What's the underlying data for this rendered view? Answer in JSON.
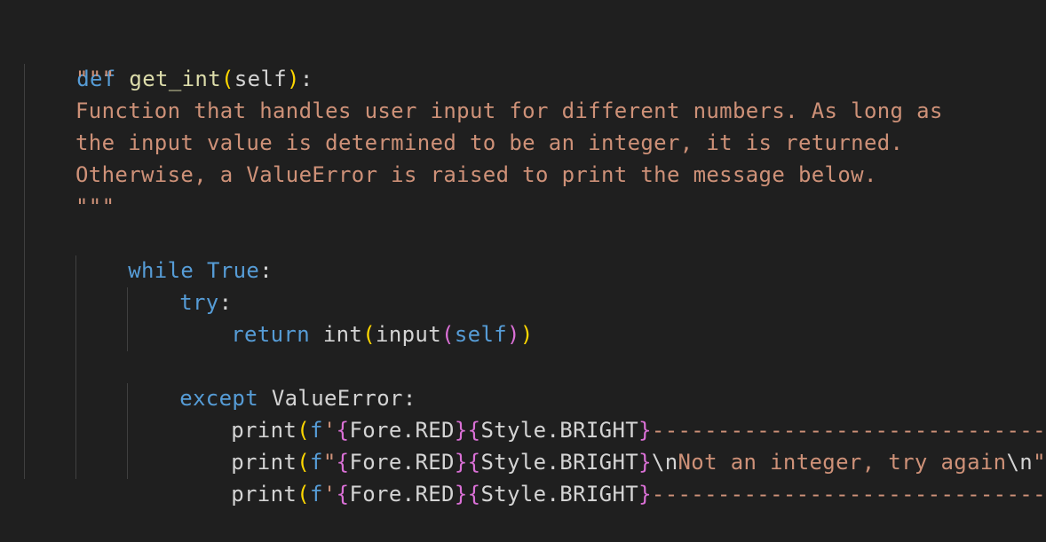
{
  "editor": {
    "theme": {
      "background": "#1f1f1f",
      "keyword": "#569cd6",
      "text": "#d4d4d4",
      "string": "#ce9178",
      "bracket_level1": "#ffd700",
      "bracket_level2": "#da70d6",
      "bracket_level3": "#179fff",
      "indent_guide": "#404040"
    },
    "line1": {
      "def": "def",
      "name": "get_int",
      "open": "(",
      "param": "self",
      "close": ")",
      "colon": ":"
    },
    "docstring": {
      "open_quotes": "\"\"\"",
      "line1": "Function that handles user input for different numbers. As long as",
      "line2": "the input value is determined to be an integer, it is returned.",
      "line3": "Otherwise, a ValueError is raised to print the message below.",
      "close_quotes": "\"\"\""
    },
    "while_line": {
      "while": "while",
      "true": "True",
      "colon": ":"
    },
    "try_line": {
      "try": "try",
      "colon": ":"
    },
    "return_line": {
      "return": "return",
      "int": "int",
      "p1o": "(",
      "input": "input",
      "p2o": "(",
      "self": "self",
      "p2c": ")",
      "p1c": ")"
    },
    "except_line": {
      "except": "except",
      "error": "ValueError",
      "colon": ":"
    },
    "print1": {
      "print": "print",
      "po": "(",
      "f": "f",
      "q_open": "'",
      "b1o": "{",
      "fore": "Fore.RED",
      "b1c": "}",
      "b2o": "{",
      "style": "Style.BRIGHT",
      "b2c": "}",
      "dashes": "------------------------------",
      "q_close": "'",
      "pc": ")"
    },
    "print2": {
      "print": "print",
      "po": "(",
      "f": "f",
      "q_open": "\"",
      "b1o": "{",
      "fore": "Fore.RED",
      "b1c": "}",
      "b2o": "{",
      "style": "Style.BRIGHT",
      "b2c": "}",
      "esc1": "\\n",
      "message": "Not an integer, try again",
      "esc2": "\\n",
      "q_close": "\"",
      "pc": ")"
    },
    "print3": {
      "print": "print",
      "po": "(",
      "f": "f",
      "q_open": "'",
      "b1o": "{",
      "fore": "Fore.RED",
      "b1c": "}",
      "b2o": "{",
      "style": "Style.BRIGHT",
      "b2c": "}",
      "dashes": "------------------------------",
      "q_close": "'",
      "pc": ")"
    }
  }
}
